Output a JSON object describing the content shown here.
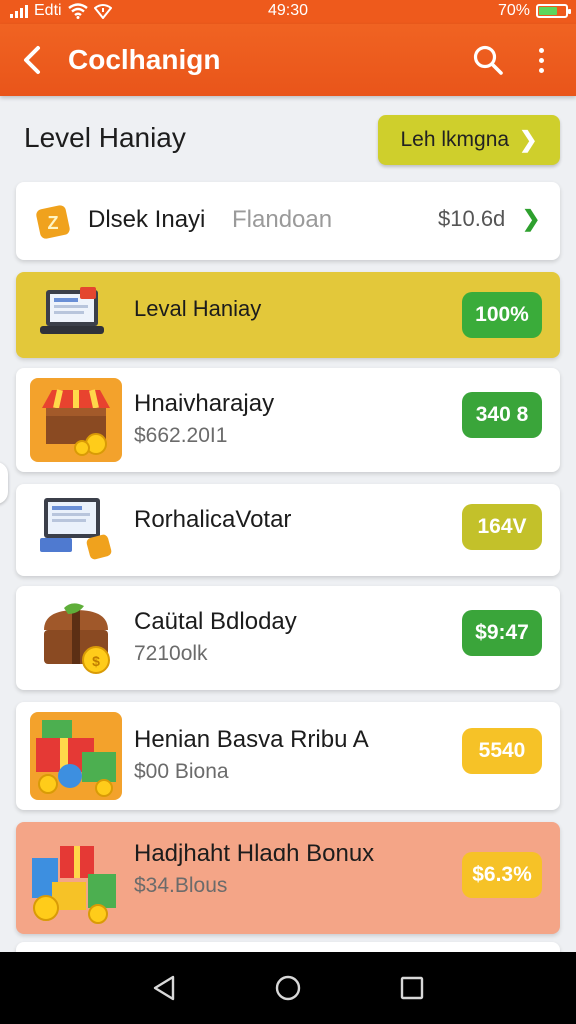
{
  "status_bar": {
    "carrier": "Edti",
    "time": "49:30",
    "battery": "70%",
    "battery_level": 0.7,
    "battery_color": "#5cd65c"
  },
  "app_bar": {
    "title": "Coclhanign",
    "background": "#ee5a1c"
  },
  "section": {
    "title": "Level Haniay",
    "action_label": "Leh lkmgna"
  },
  "summary_row": {
    "title": "Dlsek Inayi",
    "subtitle": "Flandoan",
    "amount": "$10.6d"
  },
  "items": [
    {
      "title": "Leval Haniay",
      "badge": "100%",
      "icon": "laptop-icon",
      "badge_color": "#3aac3a",
      "card_color": "#e3c83a"
    },
    {
      "title": "Hnaivharajay",
      "subtitle": "$662.20I1",
      "badge": "340 8",
      "icon": "treasure-shop-icon",
      "badge_color": "#3aa53a",
      "card_color": "#ffffff"
    },
    {
      "title": "RorhalicaVotar",
      "badge": "164V",
      "icon": "monitor-icon",
      "badge_color": "#c3c12a",
      "card_color": "#ffffff"
    },
    {
      "title": "Caütal Bdloday",
      "subtitle": "7210olk",
      "badge": "$9:47",
      "icon": "treasure-chest-icon",
      "badge_color": "#3aa53a",
      "card_color": "#ffffff"
    },
    {
      "title": "Henian Basva Rribu A",
      "subtitle": "$00 Biona",
      "badge": "5540",
      "icon": "gift-boxes-icon",
      "badge_color": "#f6c227",
      "card_color": "#ffffff"
    },
    {
      "title": "Hadjhaht Hlaɑh Bonux",
      "subtitle": "$34.Blous",
      "badge": "$6.3%",
      "icon": "bonus-gifts-icon",
      "badge_color": "#f6c227",
      "card_color": "#f4a587"
    }
  ],
  "nav": {
    "back": "back-icon",
    "home": "home-icon",
    "recents": "recents-icon"
  }
}
